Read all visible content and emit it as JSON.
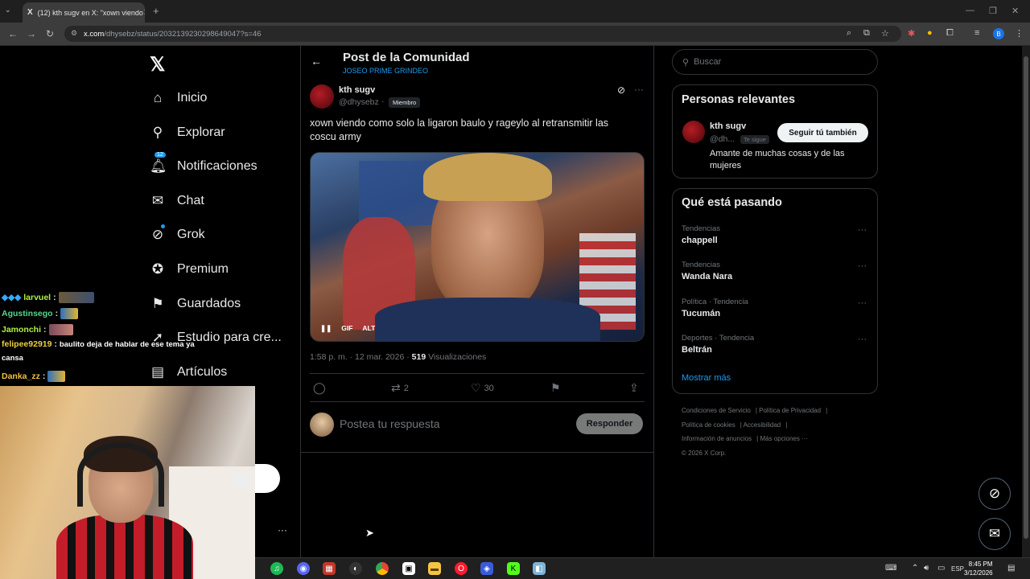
{
  "browser": {
    "tab_title": "(12) kth sugv en X: \"xown viendo",
    "tab_close": "✕",
    "new_tab": "+",
    "url_domain": "x.com",
    "url_path": "/dhysebz/status/2032139230298649047?s=46"
  },
  "nav": {
    "logo": "𝕏",
    "items": [
      {
        "label": "Inicio",
        "icon": "home-icon"
      },
      {
        "label": "Explorar",
        "icon": "search-icon"
      },
      {
        "label": "Notificaciones",
        "icon": "bell-icon",
        "badge": "12"
      },
      {
        "label": "Chat",
        "icon": "mail-icon"
      },
      {
        "label": "Grok",
        "icon": "grok-icon"
      },
      {
        "label": "Premium",
        "icon": "verified-icon"
      },
      {
        "label": "Guardados",
        "icon": "bookmark-icon"
      },
      {
        "label": "Estudio para cre...",
        "icon": "rocket-icon"
      },
      {
        "label": "Artículos",
        "icon": "article-icon"
      }
    ],
    "more": "···"
  },
  "post": {
    "header_title": "Post de la Comunidad",
    "community": "JOSEO PRIME GRINDEO",
    "author_name": "kth sugv",
    "author_handle": "@dhysebz",
    "member_badge": "Miembro",
    "text": "xown viendo como solo la ligaron baulo y rageylo al retransmitir las coscu army",
    "media_controls": {
      "pause": "❚❚",
      "gif": "GIF",
      "alt": "ALT"
    },
    "time": "1:58 p. m. · 12 mar. 2026 · ",
    "views_count": "519",
    "views_label": " Visualizaciones",
    "reposts": "2",
    "likes": "30",
    "reply_placeholder": "Postea tu respuesta",
    "reply_button": "Responder"
  },
  "sidebar": {
    "search_placeholder": "Buscar",
    "relevant_title": "Personas relevantes",
    "relevant_user": {
      "name": "kth sugv",
      "handle": "@dh...",
      "follows_you": "Te sigue",
      "follow_button": "Seguir tú también",
      "bio": "Amante de muchas cosas y de las mujeres"
    },
    "trends_title": "Qué está pasando",
    "trends": [
      {
        "category": "Tendencias",
        "name": "chappell"
      },
      {
        "category": "Tendencias",
        "name": "Wanda Nara"
      },
      {
        "category": "Política · Tendencia",
        "name": "Tucumán"
      },
      {
        "category": "Deportes · Tendencia",
        "name": "Beltrán"
      }
    ],
    "show_more": "Mostrar más",
    "footer": {
      "terms": "Condiciones de Servicio",
      "privacy": "Política de Privacidad",
      "cookies": "Política de cookies",
      "accessibility": "Accesibilidad",
      "ads": "Información de anuncios",
      "more": "Más opciones ···",
      "copyright": "© 2026 X Corp."
    }
  },
  "stream_chat": [
    {
      "user": "larvuel",
      "message": "",
      "user_color": "#b0f040"
    },
    {
      "user": "Agustinsego",
      "message": "",
      "user_color": "#50d890"
    },
    {
      "user": "Jamonchi",
      "message": "",
      "user_color": "#b0f040"
    },
    {
      "user": "felipee92919",
      "message": "baulito deja de hablar de ese tema ya cansa",
      "user_color": "#f0d040"
    },
    {
      "user": "Danka_zz",
      "message": "",
      "user_color": "#f0c040"
    }
  ],
  "taskbar": {
    "lang": "ESP",
    "time": "8:45 PM",
    "date": "3/12/2026"
  },
  "colors": {
    "accent": "#1d9bf0",
    "background": "#000000",
    "border": "#2f3336"
  }
}
